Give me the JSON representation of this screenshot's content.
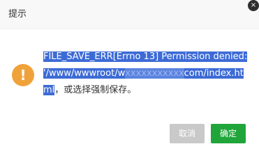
{
  "dialog": {
    "title": "提示",
    "close_symbol": "×",
    "icon": {
      "name": "exclamation-icon",
      "glyph": "!",
      "color": "#f0a23a"
    },
    "message": {
      "selected_part1": "FILE_SAVE_ERR[Errno 13] Permission denied: '/www/wwwroot/w",
      "selected_redacted": "xxxxxxxxxxx",
      "selected_part2": "com/index.html",
      "tail": "，或选择强制保存。"
    },
    "buttons": {
      "cancel_label": "取消",
      "ok_label": "确定"
    },
    "colors": {
      "selection": "#3d6bd6",
      "ok": "#20a53a",
      "cancel": "#c9c9c9"
    }
  }
}
